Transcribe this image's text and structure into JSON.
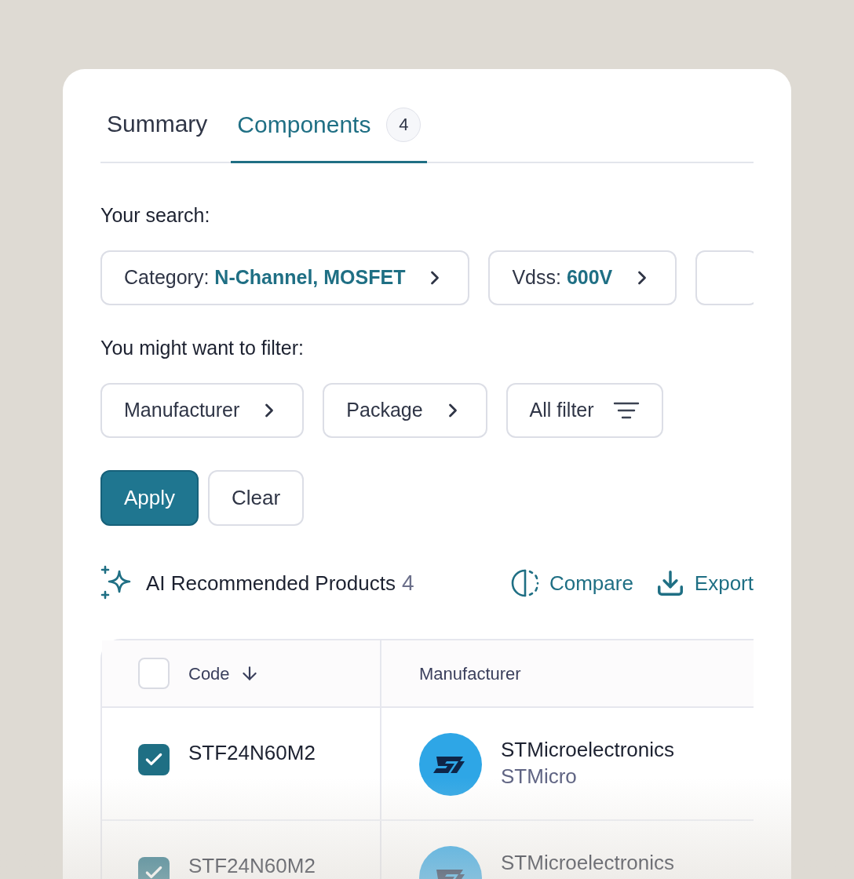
{
  "tabs": [
    {
      "label": "Summary",
      "selected": false
    },
    {
      "label": "Components",
      "selected": true,
      "count": "4"
    }
  ],
  "search": {
    "label": "Your search:",
    "chips": [
      {
        "name": "Category:",
        "value": "N-Channel, MOSFET"
      },
      {
        "name": "Vdss:",
        "value": "600V"
      }
    ]
  },
  "filter": {
    "label": "You might want to filter:",
    "chips": [
      {
        "label": "Manufacturer",
        "kind": "menu"
      },
      {
        "label": "Package",
        "kind": "menu"
      },
      {
        "label": "All filter",
        "kind": "filter"
      }
    ]
  },
  "buttons": [
    {
      "label": "Apply",
      "kind": "primary"
    },
    {
      "label": "Clear",
      "kind": "secondary"
    }
  ],
  "results": {
    "title": "AI Recommended Products",
    "count": "4",
    "actions": [
      {
        "label": "Compare",
        "kind": "compare"
      },
      {
        "label": "Export",
        "kind": "export"
      }
    ]
  },
  "table": {
    "select_all": {
      "checked": false
    },
    "columns": [
      {
        "label": "Code",
        "sorted": true
      },
      {
        "label": "Manufacturer",
        "sorted": false
      }
    ],
    "rows": [
      {
        "checked": true,
        "code": "STF24N60M2",
        "manufacturer": "STMicroelectronics",
        "short_name": "STMicro"
      },
      {
        "checked": true,
        "code": "STF24N60M2",
        "manufacturer": "STMicroelectronics"
      }
    ]
  }
}
